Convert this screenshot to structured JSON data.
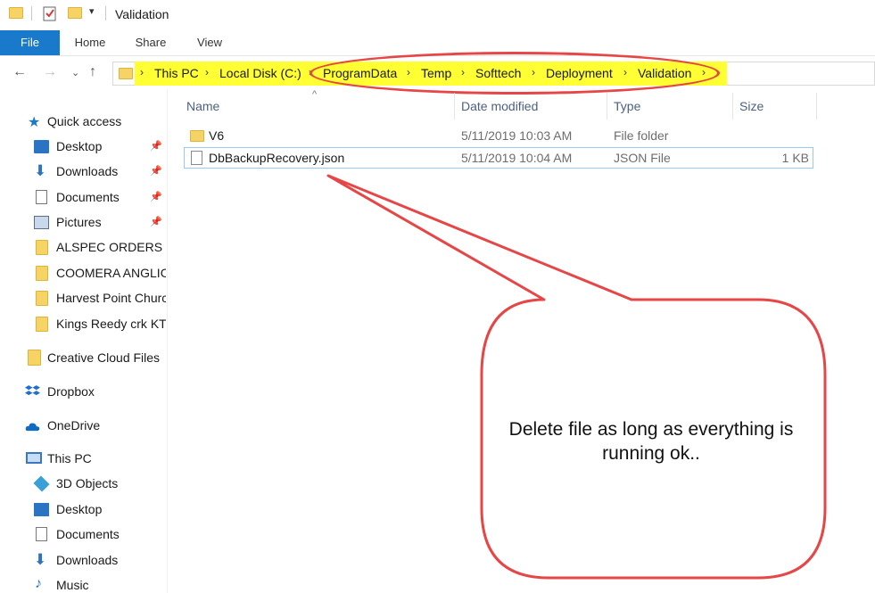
{
  "window": {
    "title": "Validation"
  },
  "ribbon": {
    "tabs": [
      "File",
      "Home",
      "Share",
      "View"
    ]
  },
  "address": {
    "crumbs": [
      "This PC",
      "Local Disk (C:)",
      "ProgramData",
      "Temp",
      "Softtech",
      "Deployment",
      "Validation"
    ],
    "highlight_color": "#ffff33",
    "annotation_color": "#e64646"
  },
  "nav": {
    "quick_access": "Quick access",
    "quick_items": [
      {
        "label": "Desktop",
        "icon": "desktop-icon",
        "pinned": true
      },
      {
        "label": "Downloads",
        "icon": "download-icon",
        "pinned": true
      },
      {
        "label": "Documents",
        "icon": "documents-icon",
        "pinned": true
      },
      {
        "label": "Pictures",
        "icon": "pictures-icon",
        "pinned": true
      },
      {
        "label": "ALSPEC ORDERS",
        "icon": "folder-icon",
        "pinned": false
      },
      {
        "label": "COOMERA ANGLIC",
        "icon": "folder-icon",
        "pinned": false
      },
      {
        "label": "Harvest Point Churc",
        "icon": "folder-icon",
        "pinned": false
      },
      {
        "label": "Kings Reedy crk KTI",
        "icon": "folder-icon",
        "pinned": false
      }
    ],
    "creative_cloud": "Creative Cloud Files",
    "dropbox": "Dropbox",
    "onedrive": "OneDrive",
    "this_pc": "This PC",
    "pc_items": [
      {
        "label": "3D Objects",
        "icon": "3d-objects-icon"
      },
      {
        "label": "Desktop",
        "icon": "desktop-icon"
      },
      {
        "label": "Documents",
        "icon": "documents-icon"
      },
      {
        "label": "Downloads",
        "icon": "download-icon"
      },
      {
        "label": "Music",
        "icon": "music-icon"
      }
    ]
  },
  "files": {
    "columns": [
      "Name",
      "Date modified",
      "Type",
      "Size"
    ],
    "rows": [
      {
        "name": "V6",
        "date": "5/11/2019 10:03 AM",
        "type": "File folder",
        "size": ""
      },
      {
        "name": "DbBackupRecovery.json",
        "date": "5/11/2019 10:04 AM",
        "type": "JSON File",
        "size": "1 KB"
      }
    ]
  },
  "callout": {
    "text": "Delete file as long as everything is running ok..",
    "border_color": "#e64646"
  }
}
